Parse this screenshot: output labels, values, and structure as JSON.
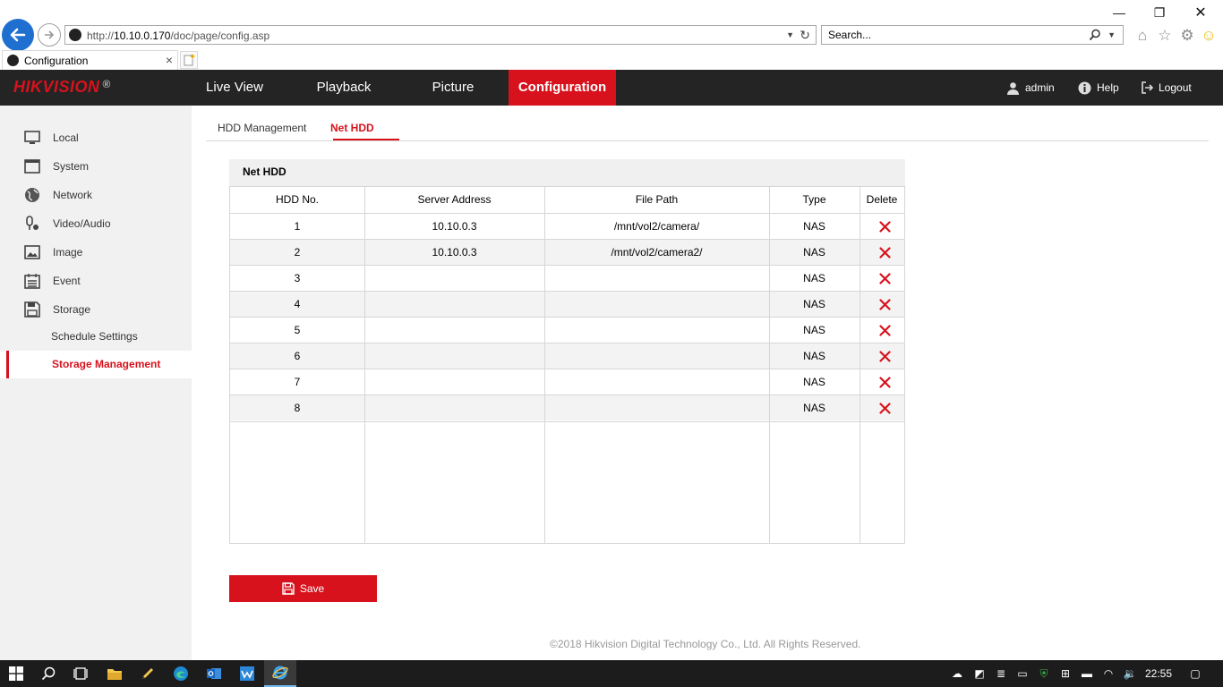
{
  "browser": {
    "url_prefix": "http://",
    "url_host": "10.10.0.170",
    "url_path": "/doc/page/config.asp",
    "search_placeholder": "Search...",
    "tab_title": "Configuration"
  },
  "header": {
    "logo_text": "HIKVISION",
    "logo_mark": "®",
    "nav": [
      {
        "label": "Live View"
      },
      {
        "label": "Playback"
      },
      {
        "label": "Picture"
      },
      {
        "label": "Configuration"
      }
    ],
    "user": "admin",
    "help": "Help",
    "logout": "Logout"
  },
  "sidebar": {
    "items": [
      {
        "label": "Local",
        "icon": "monitor-icon"
      },
      {
        "label": "System",
        "icon": "system-icon"
      },
      {
        "label": "Network",
        "icon": "globe-icon"
      },
      {
        "label": "Video/Audio",
        "icon": "mic-camera-icon"
      },
      {
        "label": "Image",
        "icon": "image-icon"
      },
      {
        "label": "Event",
        "icon": "calendar-icon"
      },
      {
        "label": "Storage",
        "icon": "floppy-icon"
      }
    ],
    "sub_items": [
      {
        "label": "Schedule Settings"
      },
      {
        "label": "Storage Management"
      }
    ]
  },
  "subtabs": [
    {
      "label": "HDD Management"
    },
    {
      "label": "Net HDD"
    }
  ],
  "panel": {
    "title": "Net HDD",
    "columns": [
      "HDD No.",
      "Server Address",
      "File Path",
      "Type",
      "Delete"
    ],
    "rows": [
      {
        "no": "1",
        "server": "10.10.0.3",
        "path": "/mnt/vol2/camera/",
        "type": "NAS"
      },
      {
        "no": "2",
        "server": "10.10.0.3",
        "path": "/mnt/vol2/camera2/",
        "type": "NAS"
      },
      {
        "no": "3",
        "server": "",
        "path": "",
        "type": "NAS"
      },
      {
        "no": "4",
        "server": "",
        "path": "",
        "type": "NAS"
      },
      {
        "no": "5",
        "server": "",
        "path": "",
        "type": "NAS"
      },
      {
        "no": "6",
        "server": "",
        "path": "",
        "type": "NAS"
      },
      {
        "no": "7",
        "server": "",
        "path": "",
        "type": "NAS"
      },
      {
        "no": "8",
        "server": "",
        "path": "",
        "type": "NAS"
      }
    ]
  },
  "save_label": "Save",
  "footer": "©2018 Hikvision Digital Technology Co., Ltd. All Rights Reserved.",
  "taskbar": {
    "clock": "22:55"
  },
  "colors": {
    "accent": "#d7121d",
    "header_bg": "#242424",
    "sidebar_bg": "#f1f1f1"
  }
}
